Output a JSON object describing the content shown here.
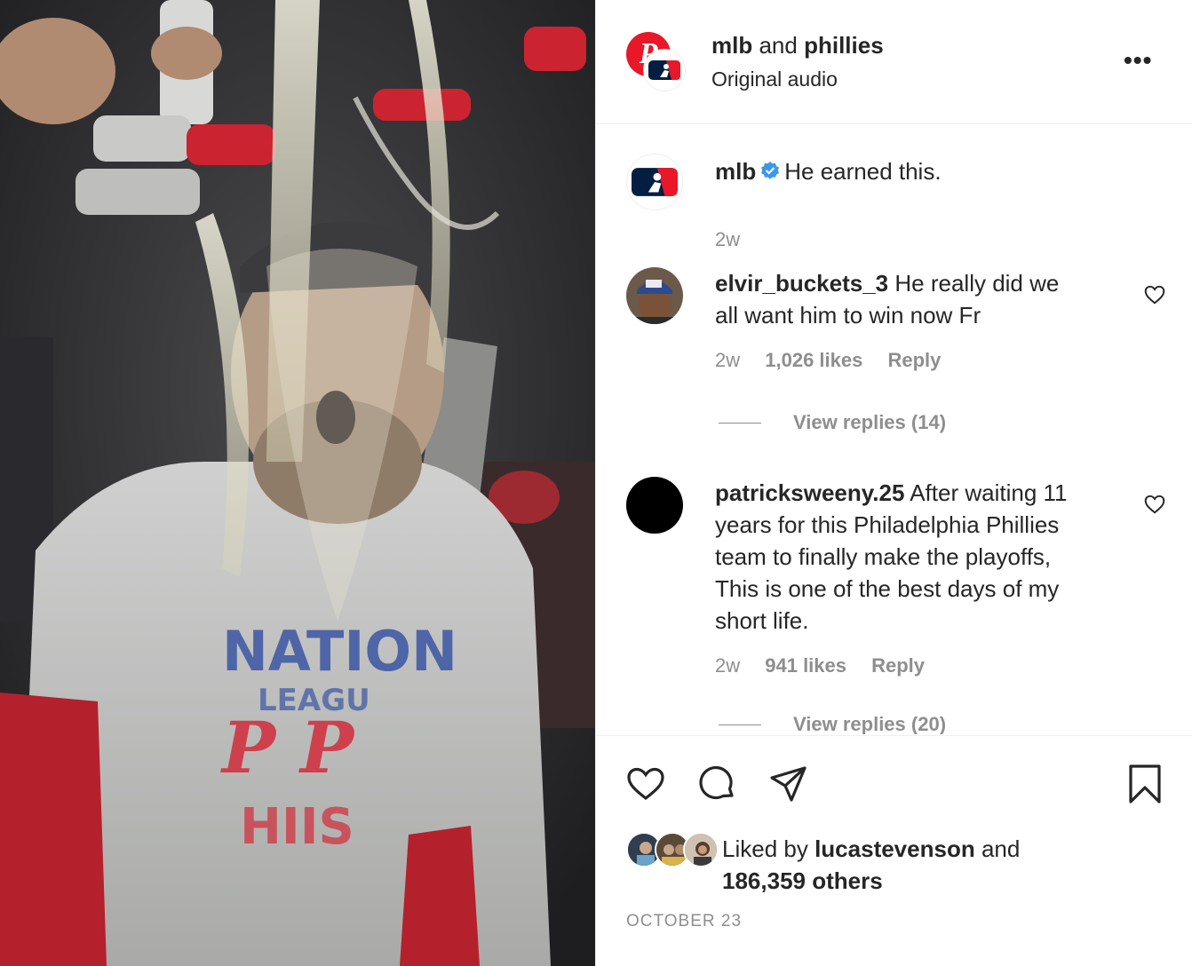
{
  "post": {
    "author_primary": "mlb",
    "connector": "and",
    "author_secondary": "phillies",
    "audio": "Original audio",
    "more_icon": "more-icon",
    "more_label": "•••"
  },
  "caption": {
    "user": "mlb",
    "verified": true,
    "text": "He earned this.",
    "time": "2w"
  },
  "comments": [
    {
      "user": "elvir_buckets_3",
      "text_line1": "He really did we",
      "text_line2": "all want him to win now Fr",
      "time": "2w",
      "likes": "1,026 likes",
      "reply": "Reply",
      "view_replies": "View replies (14)"
    },
    {
      "user": "patricksweeny.25",
      "text_line1": "After waiting 11",
      "text_line2": "years for this Philadelphia Phillies",
      "text_line3": "team to finally make the playoffs,",
      "text_line4": "This is one of the best days of my",
      "text_line5": "short life.",
      "time": "2w",
      "likes": "941 likes",
      "reply": "Reply",
      "view_replies": "View replies (20)"
    }
  ],
  "likes_summary": {
    "prefix": "Liked by",
    "user": "lucastevenson",
    "connector": "and",
    "others": "186,359 others"
  },
  "date": "OCTOBER 23",
  "colors": {
    "phillies_red": "#e81828",
    "mlb_blue": "#041e42",
    "verified_blue": "#3897f0",
    "secondary_text": "#8e8e8e"
  }
}
